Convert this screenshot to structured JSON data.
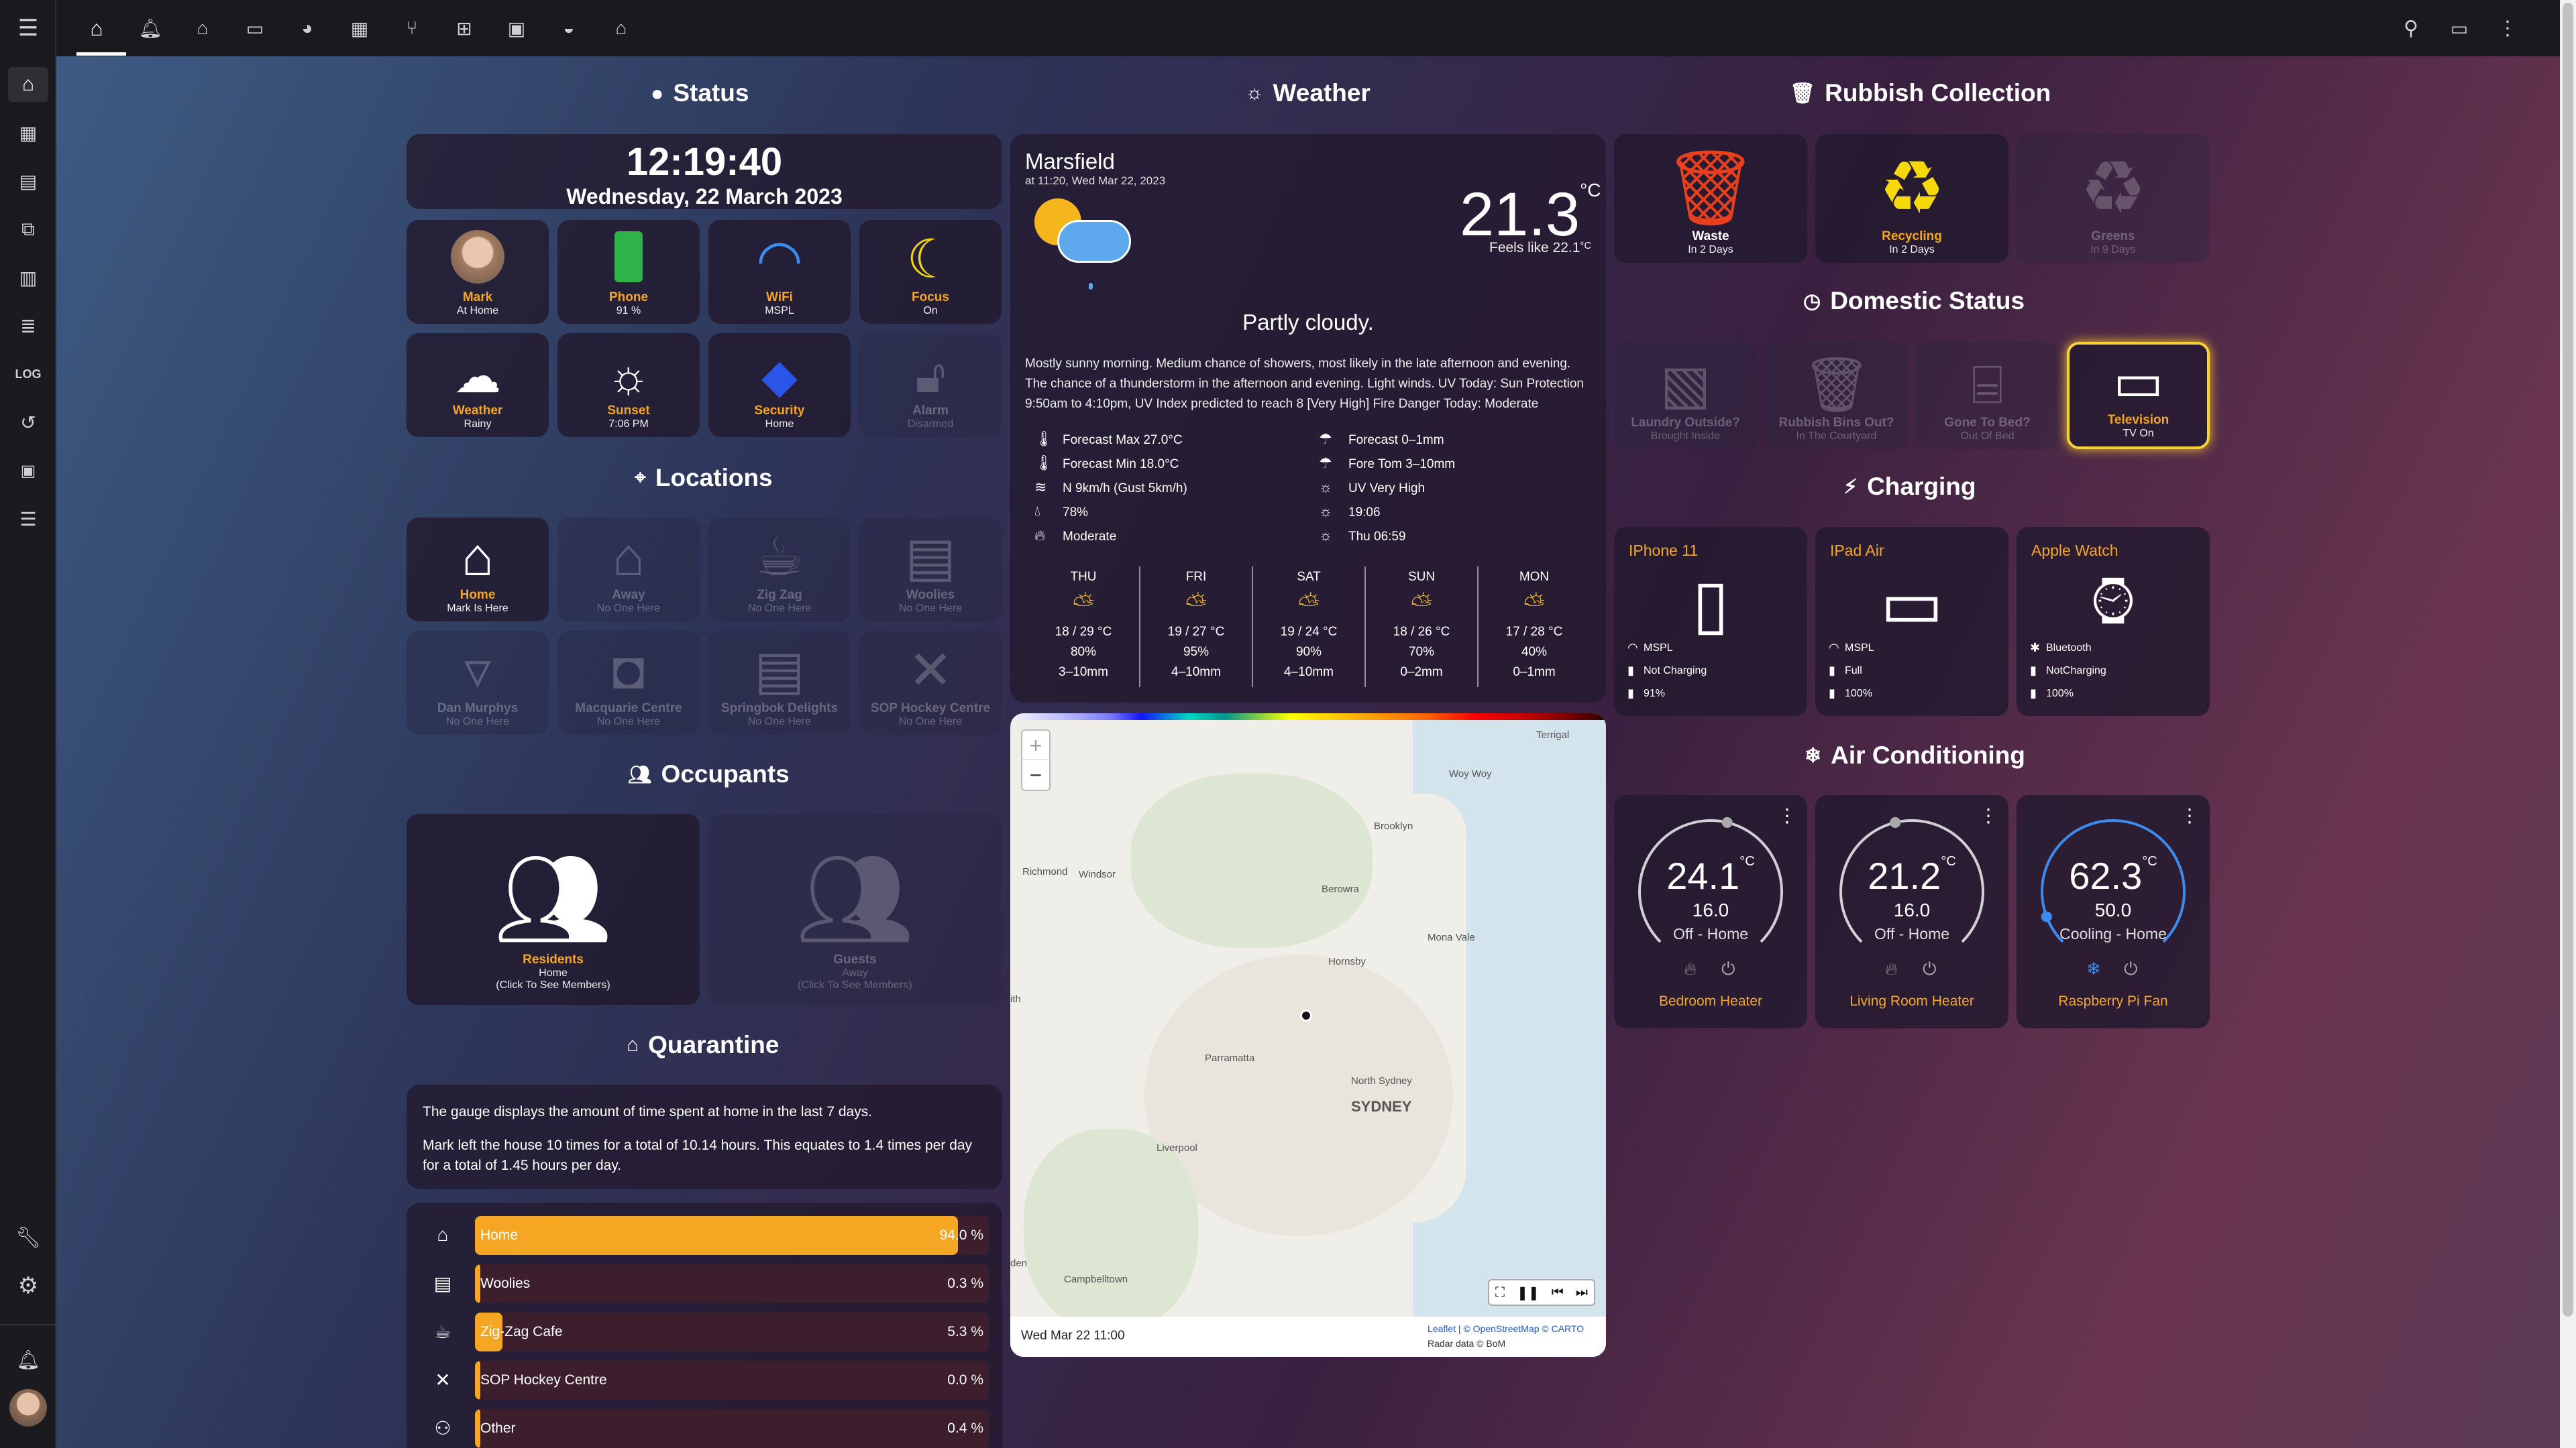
{
  "nav": {
    "menu_icon": "menu-icon",
    "tabs": [
      "home-icon",
      "bell-icon",
      "house-icon",
      "monitor-icon",
      "pie-icon",
      "film-icon",
      "fork-icon",
      "grid-icon",
      "robot-icon",
      "car-icon",
      "home-gear-icon"
    ],
    "right": [
      "search-icon",
      "chat-icon",
      "more-icon"
    ]
  },
  "sidebar": {
    "items": [
      "home-icon",
      "calendar-icon",
      "store-icon",
      "code-icon",
      "chart-icon",
      "list-icon",
      "LOG",
      "history-icon",
      "terminal-icon",
      "server-icon"
    ],
    "bottom": [
      "wrench-icon",
      "gear-icon",
      "bell-icon",
      "avatar"
    ]
  },
  "status": {
    "title": "Status",
    "time": "12:19:40",
    "date": "Wednesday, 22 March 2023",
    "tiles": [
      {
        "name": "Mark",
        "state": "At Home"
      },
      {
        "name": "Phone",
        "state": "91 %"
      },
      {
        "name": "WiFi",
        "state": "MSPL"
      },
      {
        "name": "Focus",
        "state": "On"
      },
      {
        "name": "Weather",
        "state": "Rainy"
      },
      {
        "name": "Sunset",
        "state": "7:06 PM"
      },
      {
        "name": "Security",
        "state": "Home"
      },
      {
        "name": "Alarm",
        "state": "Disarmed"
      }
    ]
  },
  "locations": {
    "title": "Locations",
    "tiles": [
      {
        "name": "Home",
        "state": "Mark Is Here"
      },
      {
        "name": "Away",
        "state": "No One Here"
      },
      {
        "name": "Zig Zag",
        "state": "No One Here"
      },
      {
        "name": "Woolies",
        "state": "No One Here"
      },
      {
        "name": "Dan Murphys",
        "state": "No One Here"
      },
      {
        "name": "Macquarie Centre",
        "state": "No One Here"
      },
      {
        "name": "Springbok Delights",
        "state": "No One Here"
      },
      {
        "name": "SOP Hockey Centre",
        "state": "No One Here"
      }
    ]
  },
  "occupants": {
    "title": "Occupants",
    "residents": {
      "name": "Residents",
      "state": "Home",
      "hint": "(Click To See Members)"
    },
    "guests": {
      "name": "Guests",
      "state": "Away",
      "hint": "(Click To See Members)"
    }
  },
  "quarantine": {
    "title": "Quarantine",
    "line1": "The gauge displays the amount of time spent at home in the last 7 days.",
    "line2": "Mark left the house 10 times for a total of 10.14 hours. This equates to 1.4 times per day",
    "line3": "for a total of 1.45 hours per day.",
    "bars": [
      {
        "label": "Home",
        "pct": "94.0 %",
        "value": 94.0
      },
      {
        "label": "Woolies",
        "pct": "0.3 %",
        "value": 0.3
      },
      {
        "label": "Zig-Zag Cafe",
        "pct": "5.3 %",
        "value": 5.3
      },
      {
        "label": "SOP Hockey Centre",
        "pct": "0.0 %",
        "value": 0.0
      },
      {
        "label": "Other",
        "pct": "0.4 %",
        "value": 0.4
      }
    ]
  },
  "weather": {
    "title": "Weather",
    "location": "Marsfield",
    "updated": "at 11:20, Wed Mar 22, 2023",
    "temp": "21.3",
    "unit": "°C",
    "feels": "Feels like 22.1",
    "feels_unit": "°C",
    "condition": "Partly cloudy.",
    "desc1": "Mostly sunny morning. Medium chance of showers, most likely in the late afternoon and evening.",
    "desc2": "The chance of a thunderstorm in the afternoon and evening. Light winds. UV Today: Sun Protection",
    "desc3": "9:50am to 4:10pm, UV Index predicted to reach 8 [Very High] Fire Danger Today: Moderate",
    "details_left": [
      "Forecast Max 27.0°C",
      "Forecast Min 18.0°C",
      "N 9km/h (Gust 5km/h)",
      "78%",
      "Moderate"
    ],
    "details_right": [
      "Forecast 0–1mm",
      "Fore Tom 3–10mm",
      "UV Very High",
      "19:06",
      "Thu 06:59"
    ],
    "forecast": [
      {
        "day": "THU",
        "temps": "18 / 29 °C",
        "rain": "80%",
        "mm": "3–10mm"
      },
      {
        "day": "FRI",
        "temps": "19 / 27 °C",
        "rain": "95%",
        "mm": "4–10mm"
      },
      {
        "day": "SAT",
        "temps": "19 / 24 °C",
        "rain": "90%",
        "mm": "4–10mm"
      },
      {
        "day": "SUN",
        "temps": "18 / 26 °C",
        "rain": "70%",
        "mm": "0–2mm"
      },
      {
        "day": "MON",
        "temps": "17 / 28 °C",
        "rain": "40%",
        "mm": "0–1mm"
      }
    ]
  },
  "map": {
    "labels": [
      "Terrigal",
      "Woy Woy",
      "Richmond",
      "Windsor",
      "Brooklyn",
      "Berowra",
      "Mona Vale",
      "Hornsby",
      "Parramatta",
      "North Sydney",
      "SYDNEY",
      "Liverpool",
      "Campbelltown",
      "ith",
      "den"
    ],
    "zoom_in": "+",
    "zoom_out": "−",
    "timestamp": "Wed Mar 22 11:00",
    "attr1": "Leaflet | © OpenStreetMap © CARTO",
    "attr2": "Radar data © BoM"
  },
  "rubbish": {
    "title": "Rubbish Collection",
    "tiles": [
      {
        "name": "Waste",
        "state": "In 2 Days"
      },
      {
        "name": "Recycling",
        "state": "In 2 Days"
      },
      {
        "name": "Greens",
        "state": "In 9 Days"
      }
    ]
  },
  "domestic": {
    "title": "Domestic Status",
    "tiles": [
      {
        "name": "Laundry Outside?",
        "state": "Brought Inside"
      },
      {
        "name": "Rubbish Bins Out?",
        "state": "In The Courtyard"
      },
      {
        "name": "Gone To Bed?",
        "state": "Out Of Bed"
      },
      {
        "name": "Television",
        "state": "TV On"
      }
    ]
  },
  "charging": {
    "title": "Charging",
    "devices": [
      {
        "name": "IPhone 11",
        "l1": "MSPL",
        "l2": "Not Charging",
        "l3": "91%"
      },
      {
        "name": "IPad Air",
        "l1": "MSPL",
        "l2": "Full",
        "l3": "100%"
      },
      {
        "name": "Apple Watch",
        "l1": "Bluetooth",
        "l2": "NotCharging",
        "l3": "100%"
      }
    ]
  },
  "aircon": {
    "title": "Air Conditioning",
    "units": [
      {
        "temp": "24.1",
        "unit": "°C",
        "target": "16.0",
        "mode": "Off - Home",
        "name": "Bedroom Heater",
        "level": 0.55
      },
      {
        "temp": "21.2",
        "unit": "°C",
        "target": "16.0",
        "mode": "Off - Home",
        "name": "Living Room Heater",
        "level": 0.45
      },
      {
        "temp": "62.3",
        "unit": "°C",
        "target": "50.0",
        "mode": "Cooling - Home",
        "name": "Raspberry Pi Fan",
        "level": 0.3
      }
    ]
  },
  "colors": {
    "accent": "#f5a623",
    "warn": "#e8401c",
    "yellow": "#f5d90a",
    "bar_fill": "#f5a623"
  }
}
